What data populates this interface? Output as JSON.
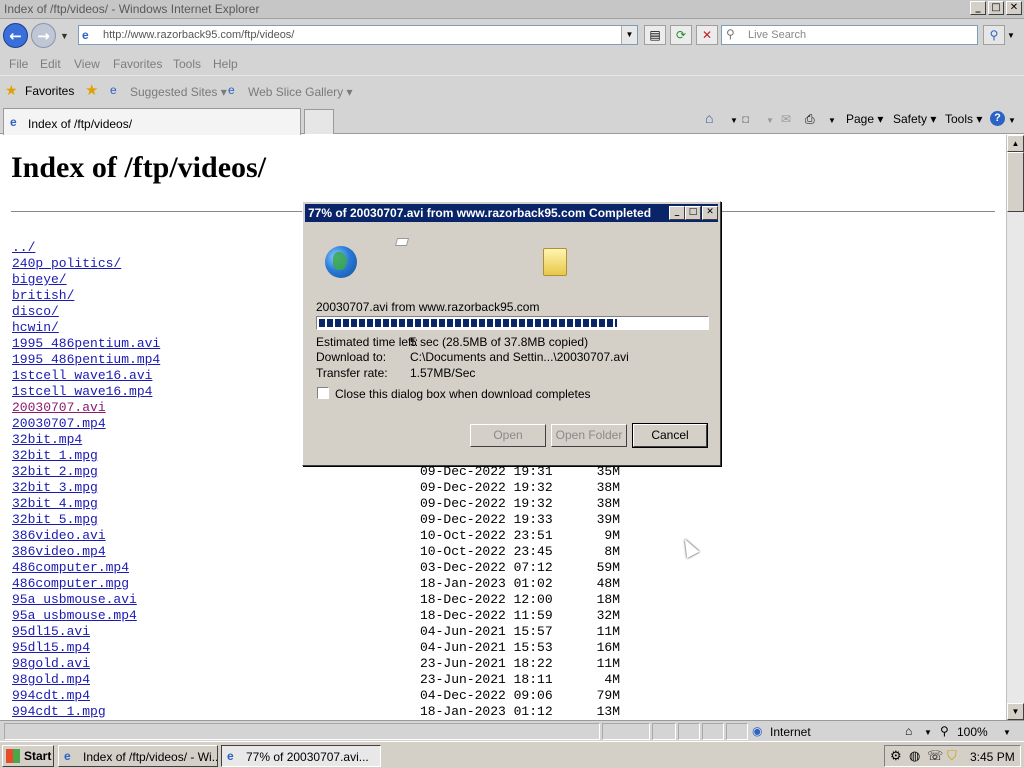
{
  "window": {
    "title": "Index of /ftp/videos/ - Windows Internet Explorer",
    "min": "_",
    "max": "□",
    "close": "✕"
  },
  "address": {
    "url": "http://www.razorback95.com/ftp/videos/",
    "search_placeholder": "Live Search"
  },
  "menu": [
    "File",
    "Edit",
    "View",
    "Favorites",
    "Tools",
    "Help"
  ],
  "favorites": {
    "label": "Favorites",
    "suggested": "Suggested Sites ▾",
    "webslice": "Web Slice Gallery ▾"
  },
  "tab": {
    "title": "Index of /ftp/videos/"
  },
  "commands": {
    "page": "Page ▾",
    "safety": "Safety ▾",
    "tools": "Tools ▾"
  },
  "page": {
    "heading": "Index of /ftp/videos/",
    "listing": [
      {
        "name": "../",
        "date": "",
        "size": ""
      },
      {
        "name": "240p_politics/",
        "date": "",
        "size": ""
      },
      {
        "name": "bigeye/",
        "date": "",
        "size": ""
      },
      {
        "name": "british/",
        "date": "",
        "size": ""
      },
      {
        "name": "disco/",
        "date": "",
        "size": ""
      },
      {
        "name": "hcwin/",
        "date": "",
        "size": ""
      },
      {
        "name": "1995_486pentium.avi",
        "date": "",
        "size": ""
      },
      {
        "name": "1995_486pentium.mp4",
        "date": "",
        "size": ""
      },
      {
        "name": "1stcell_wave16.avi",
        "date": "",
        "size": ""
      },
      {
        "name": "1stcell_wave16.mp4",
        "date": "",
        "size": ""
      },
      {
        "name": "20030707.avi",
        "date": "",
        "size": "",
        "visited": true
      },
      {
        "name": "20030707.mp4",
        "date": "",
        "size": ""
      },
      {
        "name": "32bit.mp4",
        "date": "",
        "size": ""
      },
      {
        "name": "32bit_1.mpg",
        "date": "",
        "size": ""
      },
      {
        "name": "32bit_2.mpg",
        "date": "09-Dec-2022 19:31",
        "size": "35M"
      },
      {
        "name": "32bit_3.mpg",
        "date": "09-Dec-2022 19:32",
        "size": "38M"
      },
      {
        "name": "32bit_4.mpg",
        "date": "09-Dec-2022 19:32",
        "size": "38M"
      },
      {
        "name": "32bit_5.mpg",
        "date": "09-Dec-2022 19:33",
        "size": "39M"
      },
      {
        "name": "386video.avi",
        "date": "10-Oct-2022 23:51",
        "size": "9M"
      },
      {
        "name": "386video.mp4",
        "date": "10-Oct-2022 23:45",
        "size": "8M"
      },
      {
        "name": "486computer.mp4",
        "date": "03-Dec-2022 07:12",
        "size": "59M"
      },
      {
        "name": "486computer.mpg",
        "date": "18-Jan-2023 01:02",
        "size": "48M"
      },
      {
        "name": "95a_usbmouse.avi",
        "date": "18-Dec-2022 12:00",
        "size": "18M"
      },
      {
        "name": "95a_usbmouse.mp4",
        "date": "18-Dec-2022 11:59",
        "size": "32M"
      },
      {
        "name": "95dl15.avi",
        "date": "04-Jun-2021 15:57",
        "size": "11M"
      },
      {
        "name": "95dl15.mp4",
        "date": "04-Jun-2021 15:53",
        "size": "16M"
      },
      {
        "name": "98gold.avi",
        "date": "23-Jun-2021 18:22",
        "size": "11M"
      },
      {
        "name": "98gold.mp4",
        "date": "23-Jun-2021 18:11",
        "size": "4M"
      },
      {
        "name": "994cdt.mp4",
        "date": "04-Dec-2022 09:06",
        "size": "79M"
      },
      {
        "name": "994cdt_1.mpg",
        "date": "18-Jan-2023 01:12",
        "size": "13M"
      }
    ]
  },
  "download": {
    "title": "77% of 20030707.avi from www.razorback95.com Completed",
    "file_line": "20030707.avi from www.razorback95.com",
    "progress": 0.77,
    "time_left_label": "Estimated time left:",
    "time_left_value": "5 sec (28.5MB of 37.8MB copied)",
    "download_to_label": "Download to:",
    "download_to_value": "C:\\Documents and Settin...\\20030707.avi",
    "rate_label": "Transfer rate:",
    "rate_value": "1.57MB/Sec",
    "close_checkbox": "Close this dialog box when download completes",
    "open": "Open",
    "open_folder": "Open Folder",
    "cancel": "Cancel"
  },
  "status": {
    "zone": "Internet",
    "zoom": "100%"
  },
  "taskbar": {
    "start": "Start",
    "task1": "Index of /ftp/videos/ - Wi...",
    "task2": "77% of 20030707.avi...",
    "clock": "3:45 PM"
  }
}
